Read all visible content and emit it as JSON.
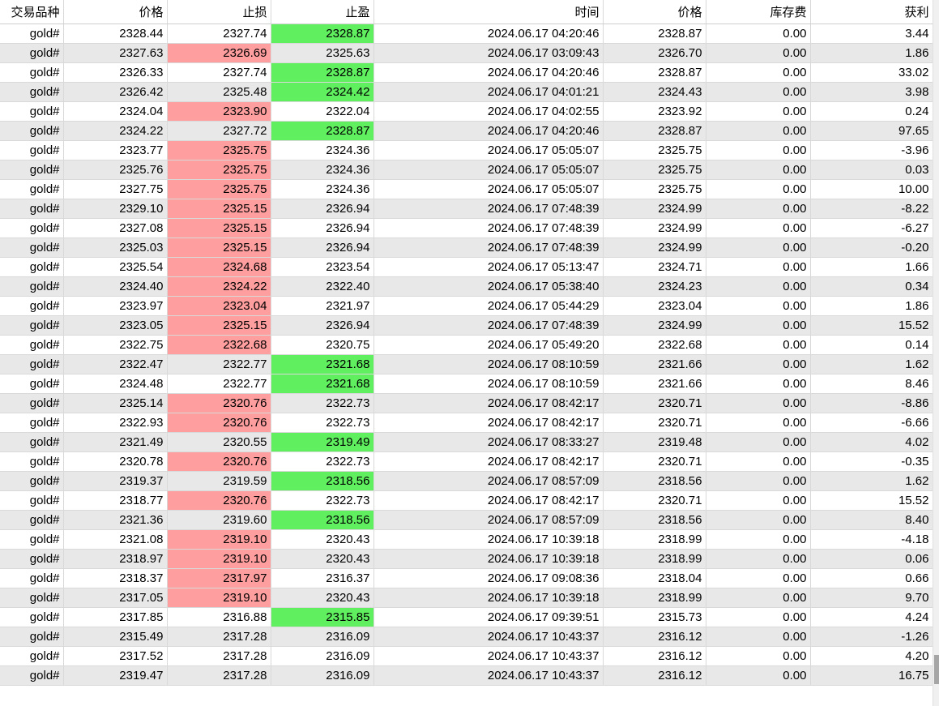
{
  "columns": [
    "交易品种",
    "价格",
    "止损",
    "止盈",
    "时间",
    "价格",
    "库存费",
    "获利"
  ],
  "colors": {
    "stop_loss_hit": "#ff9e9e",
    "take_profit_hit": "#5fef5f",
    "alt_row": "#e8e8e8"
  },
  "rows": [
    {
      "symbol": "gold#",
      "price": "2328.44",
      "sl": "2327.74",
      "tp": "2328.87",
      "time": "2024.06.17 04:20:46",
      "close": "2328.87",
      "swap": "0.00",
      "profit": "3.44",
      "hl": "tp"
    },
    {
      "symbol": "gold#",
      "price": "2327.63",
      "sl": "2326.69",
      "tp": "2325.63",
      "time": "2024.06.17 03:09:43",
      "close": "2326.70",
      "swap": "0.00",
      "profit": "1.86",
      "hl": "sl"
    },
    {
      "symbol": "gold#",
      "price": "2326.33",
      "sl": "2327.74",
      "tp": "2328.87",
      "time": "2024.06.17 04:20:46",
      "close": "2328.87",
      "swap": "0.00",
      "profit": "33.02",
      "hl": "tp"
    },
    {
      "symbol": "gold#",
      "price": "2326.42",
      "sl": "2325.48",
      "tp": "2324.42",
      "time": "2024.06.17 04:01:21",
      "close": "2324.43",
      "swap": "0.00",
      "profit": "3.98",
      "hl": "tp"
    },
    {
      "symbol": "gold#",
      "price": "2324.04",
      "sl": "2323.90",
      "tp": "2322.04",
      "time": "2024.06.17 04:02:55",
      "close": "2323.92",
      "swap": "0.00",
      "profit": "0.24",
      "hl": "sl"
    },
    {
      "symbol": "gold#",
      "price": "2324.22",
      "sl": "2327.72",
      "tp": "2328.87",
      "time": "2024.06.17 04:20:46",
      "close": "2328.87",
      "swap": "0.00",
      "profit": "97.65",
      "hl": "tp"
    },
    {
      "symbol": "gold#",
      "price": "2323.77",
      "sl": "2325.75",
      "tp": "2324.36",
      "time": "2024.06.17 05:05:07",
      "close": "2325.75",
      "swap": "0.00",
      "profit": "-3.96",
      "hl": "sl"
    },
    {
      "symbol": "gold#",
      "price": "2325.76",
      "sl": "2325.75",
      "tp": "2324.36",
      "time": "2024.06.17 05:05:07",
      "close": "2325.75",
      "swap": "0.00",
      "profit": "0.03",
      "hl": "sl"
    },
    {
      "symbol": "gold#",
      "price": "2327.75",
      "sl": "2325.75",
      "tp": "2324.36",
      "time": "2024.06.17 05:05:07",
      "close": "2325.75",
      "swap": "0.00",
      "profit": "10.00",
      "hl": "sl"
    },
    {
      "symbol": "gold#",
      "price": "2329.10",
      "sl": "2325.15",
      "tp": "2326.94",
      "time": "2024.06.17 07:48:39",
      "close": "2324.99",
      "swap": "0.00",
      "profit": "-8.22",
      "hl": "sl"
    },
    {
      "symbol": "gold#",
      "price": "2327.08",
      "sl": "2325.15",
      "tp": "2326.94",
      "time": "2024.06.17 07:48:39",
      "close": "2324.99",
      "swap": "0.00",
      "profit": "-6.27",
      "hl": "sl"
    },
    {
      "symbol": "gold#",
      "price": "2325.03",
      "sl": "2325.15",
      "tp": "2326.94",
      "time": "2024.06.17 07:48:39",
      "close": "2324.99",
      "swap": "0.00",
      "profit": "-0.20",
      "hl": "sl"
    },
    {
      "symbol": "gold#",
      "price": "2325.54",
      "sl": "2324.68",
      "tp": "2323.54",
      "time": "2024.06.17 05:13:47",
      "close": "2324.71",
      "swap": "0.00",
      "profit": "1.66",
      "hl": "sl"
    },
    {
      "symbol": "gold#",
      "price": "2324.40",
      "sl": "2324.22",
      "tp": "2322.40",
      "time": "2024.06.17 05:38:40",
      "close": "2324.23",
      "swap": "0.00",
      "profit": "0.34",
      "hl": "sl"
    },
    {
      "symbol": "gold#",
      "price": "2323.97",
      "sl": "2323.04",
      "tp": "2321.97",
      "time": "2024.06.17 05:44:29",
      "close": "2323.04",
      "swap": "0.00",
      "profit": "1.86",
      "hl": "sl"
    },
    {
      "symbol": "gold#",
      "price": "2323.05",
      "sl": "2325.15",
      "tp": "2326.94",
      "time": "2024.06.17 07:48:39",
      "close": "2324.99",
      "swap": "0.00",
      "profit": "15.52",
      "hl": "sl"
    },
    {
      "symbol": "gold#",
      "price": "2322.75",
      "sl": "2322.68",
      "tp": "2320.75",
      "time": "2024.06.17 05:49:20",
      "close": "2322.68",
      "swap": "0.00",
      "profit": "0.14",
      "hl": "sl"
    },
    {
      "symbol": "gold#",
      "price": "2322.47",
      "sl": "2322.77",
      "tp": "2321.68",
      "time": "2024.06.17 08:10:59",
      "close": "2321.66",
      "swap": "0.00",
      "profit": "1.62",
      "hl": "tp"
    },
    {
      "symbol": "gold#",
      "price": "2324.48",
      "sl": "2322.77",
      "tp": "2321.68",
      "time": "2024.06.17 08:10:59",
      "close": "2321.66",
      "swap": "0.00",
      "profit": "8.46",
      "hl": "tp"
    },
    {
      "symbol": "gold#",
      "price": "2325.14",
      "sl": "2320.76",
      "tp": "2322.73",
      "time": "2024.06.17 08:42:17",
      "close": "2320.71",
      "swap": "0.00",
      "profit": "-8.86",
      "hl": "sl"
    },
    {
      "symbol": "gold#",
      "price": "2322.93",
      "sl": "2320.76",
      "tp": "2322.73",
      "time": "2024.06.17 08:42:17",
      "close": "2320.71",
      "swap": "0.00",
      "profit": "-6.66",
      "hl": "sl"
    },
    {
      "symbol": "gold#",
      "price": "2321.49",
      "sl": "2320.55",
      "tp": "2319.49",
      "time": "2024.06.17 08:33:27",
      "close": "2319.48",
      "swap": "0.00",
      "profit": "4.02",
      "hl": "tp"
    },
    {
      "symbol": "gold#",
      "price": "2320.78",
      "sl": "2320.76",
      "tp": "2322.73",
      "time": "2024.06.17 08:42:17",
      "close": "2320.71",
      "swap": "0.00",
      "profit": "-0.35",
      "hl": "sl"
    },
    {
      "symbol": "gold#",
      "price": "2319.37",
      "sl": "2319.59",
      "tp": "2318.56",
      "time": "2024.06.17 08:57:09",
      "close": "2318.56",
      "swap": "0.00",
      "profit": "1.62",
      "hl": "tp"
    },
    {
      "symbol": "gold#",
      "price": "2318.77",
      "sl": "2320.76",
      "tp": "2322.73",
      "time": "2024.06.17 08:42:17",
      "close": "2320.71",
      "swap": "0.00",
      "profit": "15.52",
      "hl": "sl"
    },
    {
      "symbol": "gold#",
      "price": "2321.36",
      "sl": "2319.60",
      "tp": "2318.56",
      "time": "2024.06.17 08:57:09",
      "close": "2318.56",
      "swap": "0.00",
      "profit": "8.40",
      "hl": "tp"
    },
    {
      "symbol": "gold#",
      "price": "2321.08",
      "sl": "2319.10",
      "tp": "2320.43",
      "time": "2024.06.17 10:39:18",
      "close": "2318.99",
      "swap": "0.00",
      "profit": "-4.18",
      "hl": "sl"
    },
    {
      "symbol": "gold#",
      "price": "2318.97",
      "sl": "2319.10",
      "tp": "2320.43",
      "time": "2024.06.17 10:39:18",
      "close": "2318.99",
      "swap": "0.00",
      "profit": "0.06",
      "hl": "sl"
    },
    {
      "symbol": "gold#",
      "price": "2318.37",
      "sl": "2317.97",
      "tp": "2316.37",
      "time": "2024.06.17 09:08:36",
      "close": "2318.04",
      "swap": "0.00",
      "profit": "0.66",
      "hl": "sl"
    },
    {
      "symbol": "gold#",
      "price": "2317.05",
      "sl": "2319.10",
      "tp": "2320.43",
      "time": "2024.06.17 10:39:18",
      "close": "2318.99",
      "swap": "0.00",
      "profit": "9.70",
      "hl": "sl"
    },
    {
      "symbol": "gold#",
      "price": "2317.85",
      "sl": "2316.88",
      "tp": "2315.85",
      "time": "2024.06.17 09:39:51",
      "close": "2315.73",
      "swap": "0.00",
      "profit": "4.24",
      "hl": "tp"
    },
    {
      "symbol": "gold#",
      "price": "2315.49",
      "sl": "2317.28",
      "tp": "2316.09",
      "time": "2024.06.17 10:43:37",
      "close": "2316.12",
      "swap": "0.00",
      "profit": "-1.26",
      "hl": ""
    },
    {
      "symbol": "gold#",
      "price": "2317.52",
      "sl": "2317.28",
      "tp": "2316.09",
      "time": "2024.06.17 10:43:37",
      "close": "2316.12",
      "swap": "0.00",
      "profit": "4.20",
      "hl": ""
    },
    {
      "symbol": "gold#",
      "price": "2319.47",
      "sl": "2317.28",
      "tp": "2316.09",
      "time": "2024.06.17 10:43:37",
      "close": "2316.12",
      "swap": "0.00",
      "profit": "16.75",
      "hl": ""
    }
  ]
}
